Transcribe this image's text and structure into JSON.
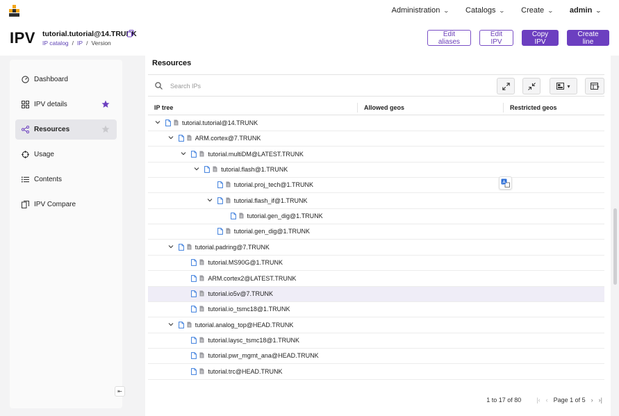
{
  "topnav": {
    "items": [
      {
        "label": "Administration"
      },
      {
        "label": "Catalogs"
      },
      {
        "label": "Create"
      }
    ],
    "user": "admin"
  },
  "header": {
    "title": "IPV",
    "ipv_name": "tutorial.tutorial@14.TRUNK",
    "breadcrumb": [
      "IP catalog",
      "/",
      "IP",
      "/",
      "Version"
    ],
    "buttons": {
      "edit_aliases": "Edit aliases",
      "edit_ipv": "Edit IPV",
      "copy_ipv": "Copy IPV",
      "create_line": "Create line"
    }
  },
  "sidebar": {
    "items": [
      {
        "label": "Dashboard",
        "icon": "dashboard-icon"
      },
      {
        "label": "IPV details",
        "icon": "grid-icon",
        "starred": true
      },
      {
        "label": "Resources",
        "icon": "share-icon",
        "active": true
      },
      {
        "label": "Usage",
        "icon": "crosshair-icon"
      },
      {
        "label": "Contents",
        "icon": "list-icon"
      },
      {
        "label": "IPV Compare",
        "icon": "compare-icon"
      }
    ]
  },
  "main": {
    "title": "Resources",
    "search": {
      "placeholder": "Search IPs",
      "value": ""
    },
    "columns": [
      "IP tree",
      "Allowed geos",
      "Restricted geos"
    ],
    "rows": [
      {
        "name": "tutorial.tutorial@14.TRUNK",
        "level": 0,
        "expanded": true
      },
      {
        "name": "ARM.cortex@7.TRUNK",
        "level": 1,
        "expanded": true
      },
      {
        "name": "tutorial.multiDM@LATEST.TRUNK",
        "level": 2,
        "expanded": true
      },
      {
        "name": "tutorial.flash@1.TRUNK",
        "level": 3,
        "expanded": true
      },
      {
        "name": "tutorial.proj_tech@1.TRUNK",
        "level": 4,
        "expanded": false
      },
      {
        "name": "tutorial.flash_if@1.TRUNK",
        "level": 4,
        "expanded": true
      },
      {
        "name": "tutorial.gen_dig@1.TRUNK",
        "level": 5,
        "expanded": false
      },
      {
        "name": "tutorial.gen_dig@1.TRUNK",
        "level": 4,
        "expanded": false
      },
      {
        "name": "tutorial.padring@7.TRUNK",
        "level": 1,
        "expanded": true
      },
      {
        "name": "tutorial.MS90G@1.TRUNK",
        "level": 2,
        "expanded": false
      },
      {
        "name": "ARM.cortex2@LATEST.TRUNK",
        "level": 2,
        "expanded": false
      },
      {
        "name": "tutorial.io5v@7.TRUNK",
        "level": 2,
        "expanded": false,
        "highlighted": true
      },
      {
        "name": "tutorial.io_tsmc18@1.TRUNK",
        "level": 2,
        "expanded": false
      },
      {
        "name": "tutorial.analog_top@HEAD.TRUNK",
        "level": 1,
        "expanded": true
      },
      {
        "name": "tutorial.laysc_tsmc18@1.TRUNK",
        "level": 2,
        "expanded": false
      },
      {
        "name": "tutorial.pwr_mgmt_ana@HEAD.TRUNK",
        "level": 2,
        "expanded": false
      },
      {
        "name": "tutorial.trc@HEAD.TRUNK",
        "level": 2,
        "expanded": false
      }
    ],
    "pagination": {
      "range": "1 to 17 of 80",
      "page": "Page 1 of 5"
    }
  },
  "colors": {
    "accent": "#6c3fc0",
    "highlight_row": "#efedf7",
    "file_icon": "#3b7ddd"
  }
}
